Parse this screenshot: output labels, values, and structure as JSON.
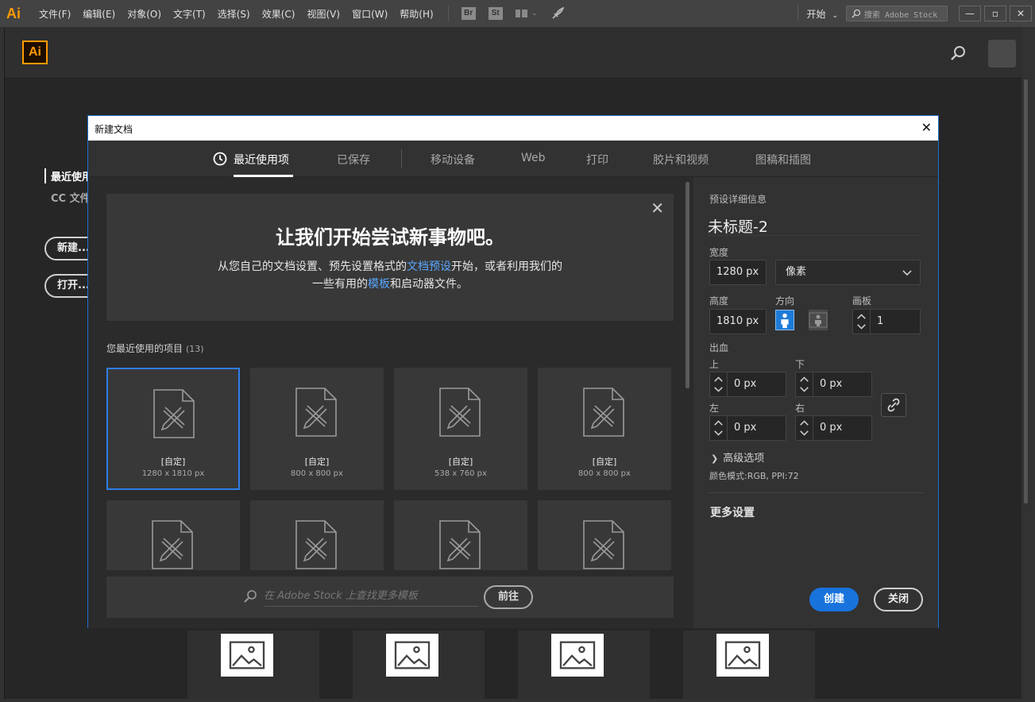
{
  "menubar": {
    "logo": "Ai",
    "items": [
      "文件(F)",
      "编辑(E)",
      "对象(O)",
      "文字(T)",
      "选择(S)",
      "效果(C)",
      "视图(V)",
      "窗口(W)",
      "帮助(H)"
    ],
    "bridge": "Br",
    "stock": "St",
    "workspace": "开始",
    "search_placeholder": "搜索 Adobe Stock"
  },
  "home": {
    "logo": "Ai",
    "nav": [
      "最近使用",
      "CC 文件"
    ],
    "new_button": "新建...",
    "open_button": "打开..."
  },
  "dialog": {
    "title": "新建文档",
    "tabs": [
      "最近使用项",
      "已保存",
      "移动设备",
      "Web",
      "打印",
      "胶片和视频",
      "图稿和插图"
    ],
    "active_tab": "最近使用项",
    "welcome": {
      "headline": "让我们开始尝试新事物吧。",
      "line1_a": "从您自己的文档设置、预先设置格式的",
      "line1_link": "文档预设",
      "line1_b": "开始，或者利用我们的",
      "line2_a": "一些有用的",
      "line2_link": "模板",
      "line2_b": "和启动器文件。"
    },
    "recent": {
      "label": "您最近使用的项目",
      "count": "(13)",
      "items": [
        {
          "name": "[自定]",
          "size": "1280 x 1810 px"
        },
        {
          "name": "[自定]",
          "size": "800 x 800 px"
        },
        {
          "name": "[自定]",
          "size": "538 x 760 px"
        },
        {
          "name": "[自定]",
          "size": "800 x 800 px"
        }
      ]
    },
    "stock": {
      "placeholder": "在 Adobe Stock 上查找更多模板",
      "go": "前往"
    },
    "details": {
      "section": "预设详细信息",
      "doc_name": "未标题-2",
      "width_label": "宽度",
      "width": "1280 px",
      "unit": "像素",
      "height_label": "高度",
      "height": "1810 px",
      "orientation_label": "方向",
      "artboards_label": "画板",
      "artboards": "1",
      "bleed_label": "出血",
      "top_label": "上",
      "top": "0 px",
      "bottom_label": "下",
      "bottom": "0 px",
      "left_label": "左",
      "left": "0 px",
      "right_label": "右",
      "right": "0 px",
      "advanced": "高级选项",
      "color_mode": "颜色模式:RGB, PPI:72",
      "more_settings": "更多设置",
      "create": "创建",
      "close": "关闭"
    }
  }
}
